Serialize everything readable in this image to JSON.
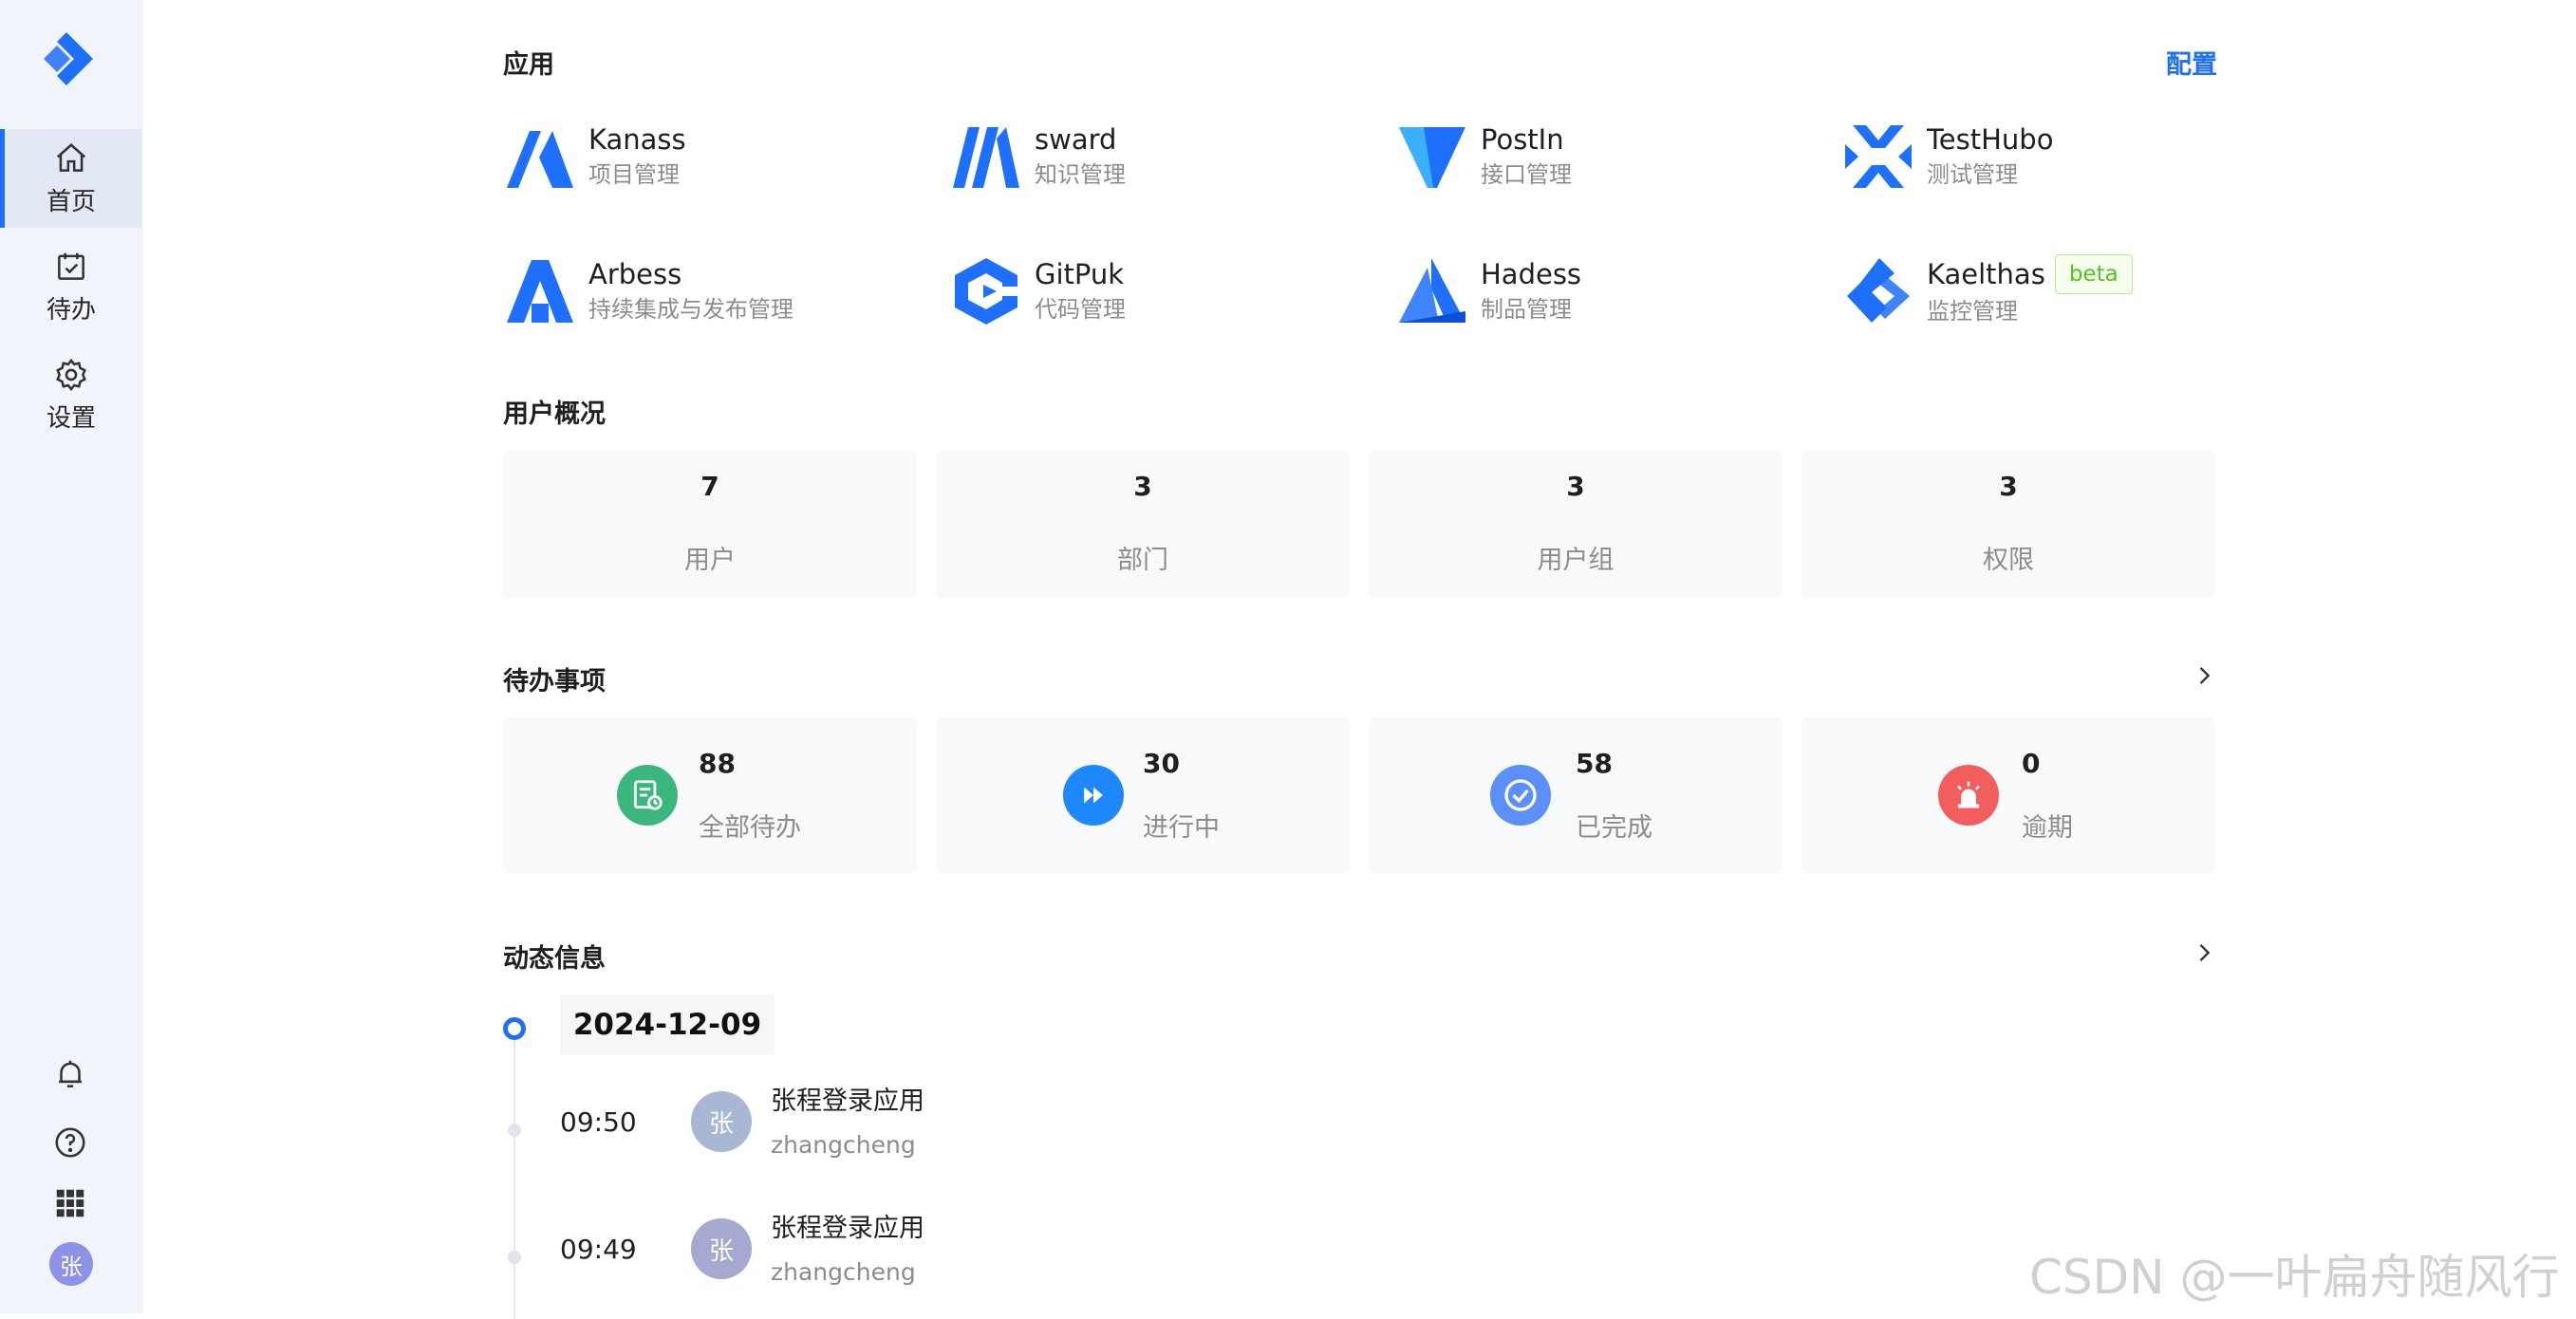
{
  "sidebar": {
    "nav": [
      {
        "label": "首页",
        "icon": "home-icon",
        "active": true
      },
      {
        "label": "待办",
        "icon": "calendar-check-icon",
        "active": false
      },
      {
        "label": "设置",
        "icon": "gear-icon",
        "active": false
      }
    ],
    "avatar_text": "张"
  },
  "apps": {
    "title": "应用",
    "config_label": "配置",
    "items": [
      {
        "name": "Kanass",
        "sub": "项目管理"
      },
      {
        "name": "sward",
        "sub": "知识管理"
      },
      {
        "name": "PostIn",
        "sub": "接口管理"
      },
      {
        "name": "TestHubo",
        "sub": "测试管理"
      },
      {
        "name": "Arbess",
        "sub": "持续集成与发布管理"
      },
      {
        "name": "GitPuk",
        "sub": "代码管理"
      },
      {
        "name": "Hadess",
        "sub": "制品管理"
      },
      {
        "name": "Kaelthas",
        "sub": "监控管理",
        "badge": "beta"
      }
    ]
  },
  "user_overview": {
    "title": "用户概况",
    "cards": [
      {
        "value": "7",
        "label": "用户"
      },
      {
        "value": "3",
        "label": "部门"
      },
      {
        "value": "3",
        "label": "用户组"
      },
      {
        "value": "3",
        "label": "权限"
      }
    ]
  },
  "todos": {
    "title": "待办事项",
    "cards": [
      {
        "value": "88",
        "label": "全部待办",
        "color": "#3bb77e"
      },
      {
        "value": "30",
        "label": "进行中",
        "color": "#1e88ff"
      },
      {
        "value": "58",
        "label": "已完成",
        "color": "#5b8ff9"
      },
      {
        "value": "0",
        "label": "逾期",
        "color": "#f25e5e"
      }
    ]
  },
  "activity": {
    "title": "动态信息",
    "date": "2024-12-09",
    "entries": [
      {
        "time": "09:50",
        "avatar": "张",
        "title": "张程登录应用",
        "user": "zhangcheng"
      },
      {
        "time": "09:49",
        "avatar": "张",
        "title": "张程登录应用",
        "user": "zhangcheng"
      }
    ]
  },
  "watermark": "CSDN @一叶扁舟随风行",
  "colors": {
    "accent": "#1e6ffb",
    "sidebar_bg": "#f1f4fa",
    "card_bg": "#f8f9fb"
  }
}
